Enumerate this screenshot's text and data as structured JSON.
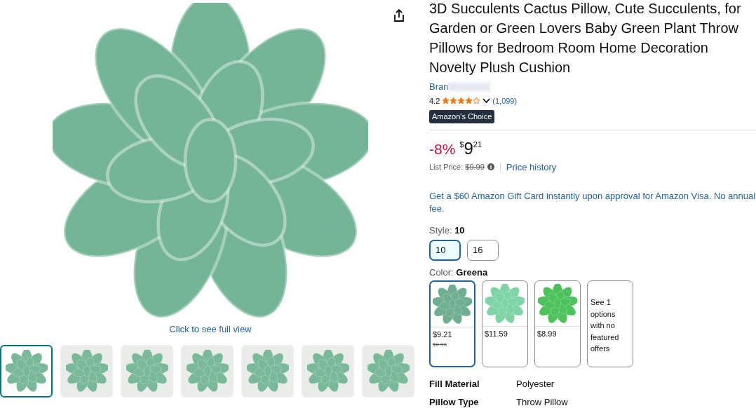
{
  "gallery": {
    "caption": "Click to see full view",
    "thumbnails": [
      {
        "selected": true
      },
      {
        "selected": false
      },
      {
        "selected": false
      },
      {
        "selected": false
      },
      {
        "selected": false
      },
      {
        "selected": false
      },
      {
        "selected": false
      }
    ]
  },
  "product": {
    "title": "3D Succulents Cactus Pillow, Cute Succulents, for Garden or Green Lovers Baby Green Plant Throw Pillows for Bedroom Room Home Decoration Novelty Plush Cushion",
    "brand": "Bran",
    "rating": "4.2",
    "stars": 4,
    "reviews": "(1,099)",
    "badge": "Amazon's Choice"
  },
  "price": {
    "discount": "-8%",
    "currency": "$",
    "whole": "9",
    "fraction": "21",
    "list_label": "List Price:",
    "list_price": "$9.99",
    "history_link": "Price history"
  },
  "promo": "Get a $60 Amazon Gift Card instantly upon approval for Amazon Visa. No annual fee.",
  "style": {
    "label": "Style:",
    "value": "10",
    "options": [
      {
        "label": "10",
        "selected": true
      },
      {
        "label": "16",
        "selected": false
      }
    ]
  },
  "color": {
    "label": "Color:",
    "value": "Greena",
    "options": [
      {
        "kind": "swatch",
        "color": "#6fae90",
        "price": "$9.21",
        "old_price": "$9.99",
        "selected": true
      },
      {
        "kind": "swatch",
        "color": "#7fd4a6",
        "price": "$11.59",
        "selected": false
      },
      {
        "kind": "swatch",
        "color": "#4cc25a",
        "price": "$8.99",
        "selected": false
      },
      {
        "kind": "text",
        "text": "See 1 options with no featured offers",
        "selected": false
      }
    ]
  },
  "specs": [
    {
      "name": "Fill Material",
      "value": "Polyester"
    },
    {
      "name": "Pillow Type",
      "value": "Throw Pillow"
    }
  ]
}
